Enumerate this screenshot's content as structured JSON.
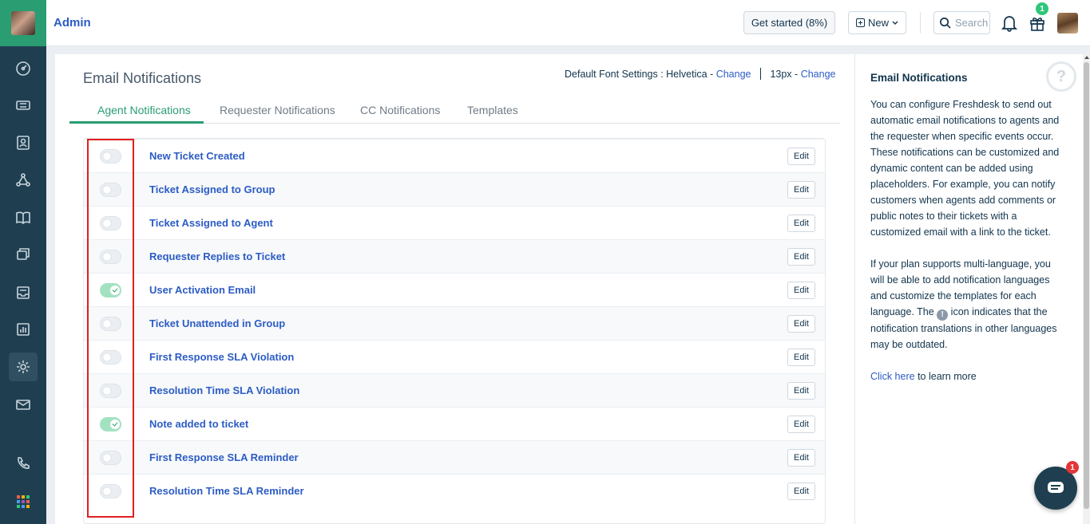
{
  "header": {
    "title": "Admin",
    "get_started": "Get started (8%)",
    "new_label": "New",
    "search_placeholder": "Search",
    "gift_badge": "1"
  },
  "page": {
    "title": "Email Notifications",
    "font_settings_label": "Default Font Settings : Helvetica -",
    "font_change_1": "Change",
    "font_size_label": "13px -",
    "font_change_2": "Change"
  },
  "tabs": [
    {
      "label": "Agent Notifications",
      "active": true
    },
    {
      "label": "Requester Notifications",
      "active": false
    },
    {
      "label": "CC Notifications",
      "active": false
    },
    {
      "label": "Templates",
      "active": false
    }
  ],
  "notifications": [
    {
      "label": "New Ticket Created",
      "enabled": false,
      "edit": "Edit"
    },
    {
      "label": "Ticket Assigned to Group",
      "enabled": false,
      "edit": "Edit"
    },
    {
      "label": "Ticket Assigned to Agent",
      "enabled": false,
      "edit": "Edit"
    },
    {
      "label": "Requester Replies to Ticket",
      "enabled": false,
      "edit": "Edit"
    },
    {
      "label": "User Activation Email",
      "enabled": true,
      "edit": "Edit"
    },
    {
      "label": "Ticket Unattended in Group",
      "enabled": false,
      "edit": "Edit"
    },
    {
      "label": "First Response SLA Violation",
      "enabled": false,
      "edit": "Edit"
    },
    {
      "label": "Resolution Time SLA Violation",
      "enabled": false,
      "edit": "Edit"
    },
    {
      "label": "Note added to ticket",
      "enabled": true,
      "edit": "Edit"
    },
    {
      "label": "First Response SLA Reminder",
      "enabled": false,
      "edit": "Edit"
    },
    {
      "label": "Resolution Time SLA Reminder",
      "enabled": false,
      "edit": "Edit"
    }
  ],
  "side_panel": {
    "title": "Email Notifications",
    "para1": "You can configure Freshdesk to send out automatic email notifications to agents and the requester when specific events occur. These notifications can be customized and dynamic content can be added using placeholders. For example, you can notify customers when agents add comments or public notes to their tickets with a customized email with a link to the ticket.",
    "para2_before": "If your plan supports multi-language, you will be able to add notification languages and customize the templates for each language. The",
    "para2_after": "icon indicates that the notification translations in other languages may be outdated.",
    "link_text": "Click here",
    "link_suffix": "to learn more",
    "help_glyph": "?"
  },
  "chat": {
    "badge": "1"
  },
  "colors": {
    "sidebar": "#1f3f51",
    "accent_green": "#2a9d72",
    "link_blue": "#2c5cc5",
    "highlight_red": "#e01f1f"
  },
  "icons": [
    "dashboard-icon",
    "tickets-icon",
    "contacts-icon",
    "social-icon",
    "solutions-icon",
    "forums-icon",
    "inbox-icon",
    "reports-icon",
    "admin-gear-icon",
    "email-icon",
    "phone-icon",
    "apps-grid-icon"
  ]
}
